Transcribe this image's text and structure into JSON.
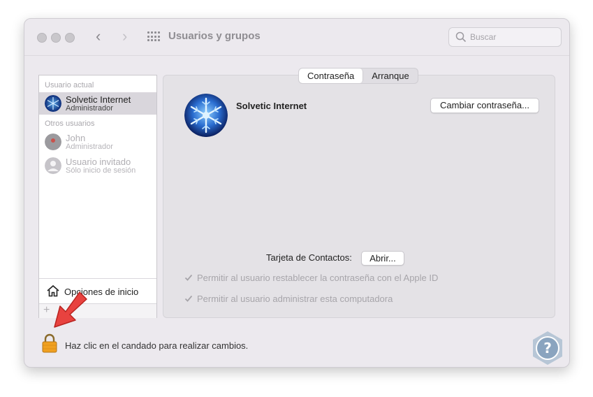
{
  "window": {
    "title": "Usuarios y grupos",
    "search_placeholder": "Buscar",
    "nav_back": "‹",
    "nav_forward": "›"
  },
  "sidebar": {
    "current_header": "Usuario actual",
    "current_user": {
      "name": "Solvetic Internet",
      "role": "Administrador"
    },
    "others_header": "Otros usuarios",
    "other_users": [
      {
        "name": "John",
        "role": "Administrador"
      },
      {
        "name": "Usuario invitado",
        "role": "Sólo inicio de sesión"
      }
    ],
    "login_options": "Opciones de inicio",
    "add_symbol": "+"
  },
  "panel": {
    "tabs": [
      "Contraseña",
      "Arranque"
    ],
    "user_name": "Solvetic Internet",
    "change_password_button": "Cambiar contraseña...",
    "contact_card_label": "Tarjeta de Contactos:",
    "open_button": "Abrir...",
    "checkboxes": [
      "Permitir al usuario restablecer la contraseña con el Apple ID",
      "Permitir al usuario administrar esta computadora"
    ]
  },
  "footer": {
    "lock_text": "Haz clic en el candado para realizar cambios."
  },
  "colors": {
    "window_bg": "#ece9ee",
    "selection": "#d9d6dc",
    "lock_gold": "#f0a020",
    "arrow_red": "#e8423f",
    "help_blue": "#8aa4bf"
  }
}
